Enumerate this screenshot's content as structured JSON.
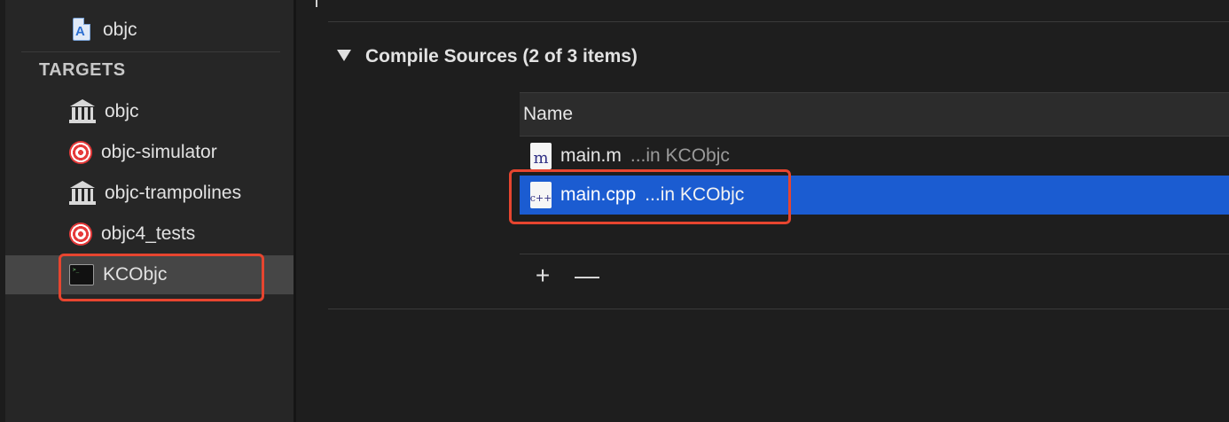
{
  "sidebar": {
    "project": {
      "label": "objc",
      "icon": "app-project-icon"
    },
    "section_header": "TARGETS",
    "targets": [
      {
        "label": "objc",
        "icon": "library-icon"
      },
      {
        "label": "objc-simulator",
        "icon": "target-icon"
      },
      {
        "label": "objc-trampolines",
        "icon": "library-icon"
      },
      {
        "label": "objc4_tests",
        "icon": "target-icon"
      },
      {
        "label": "KCObjc",
        "icon": "terminal-icon",
        "selected": true
      }
    ]
  },
  "main": {
    "phase": {
      "title": "Compile Sources (2 of 3 items)",
      "expanded": true
    },
    "table": {
      "header": "Name",
      "rows": [
        {
          "file": "main.m",
          "location": "...in KCObjc",
          "icon_glyph": "m",
          "selected": false
        },
        {
          "file": "main.cpp",
          "location": "...in KCObjc",
          "icon_glyph": "c++",
          "selected": true
        }
      ]
    },
    "add_label": "+",
    "remove_label": "—"
  },
  "colors": {
    "selection_blue": "#1b5cd1",
    "highlight_red": "#e7452f",
    "sidebar_selected": "#464646"
  }
}
